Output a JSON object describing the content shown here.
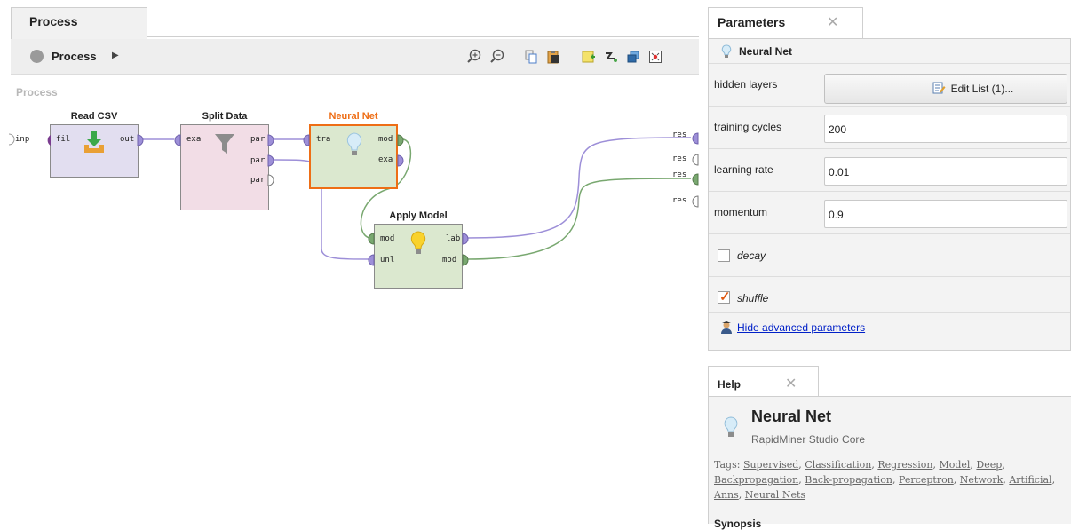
{
  "process_panel": {
    "tab_label": "Process",
    "breadcrumb": "Process",
    "canvas_label": "Process",
    "input_port": "inp",
    "toolbar_icons": [
      "zoom-in-icon",
      "zoom-out-icon",
      "copy-icon",
      "paste-icon",
      "add-note-icon",
      "auto-wire-icon",
      "layers-icon",
      "fit-view-icon"
    ],
    "result_ports": [
      "res",
      "res",
      "res",
      "res"
    ],
    "operators": {
      "read_csv": {
        "title": "Read CSV",
        "in": [
          "fil"
        ],
        "out": [
          "out"
        ]
      },
      "split_data": {
        "title": "Split Data",
        "in": [
          "exa"
        ],
        "out": [
          "par",
          "par",
          "par"
        ]
      },
      "neural_net": {
        "title": "Neural Net",
        "in": [
          "tra"
        ],
        "out": [
          "mod",
          "exa"
        ]
      },
      "apply_model": {
        "title": "Apply Model",
        "in": [
          "mod",
          "unl"
        ],
        "out": [
          "lab",
          "mod"
        ]
      }
    },
    "colors": {
      "selected_operator_title": "#ee6e16",
      "example_port": "#9d8fd8",
      "model_port": "#79a870",
      "file_port": "#7a3c8f"
    }
  },
  "parameters_panel": {
    "tab_label": "Parameters",
    "operator_name": "Neural Net",
    "params": [
      {
        "label": "hidden layers",
        "button": "Edit List (1)..."
      },
      {
        "label": "training cycles",
        "value": "200"
      },
      {
        "label": "learning rate",
        "value": "0.01"
      },
      {
        "label": "momentum",
        "value": "0.9"
      }
    ],
    "checkboxes": [
      {
        "label": "decay",
        "checked": false
      },
      {
        "label": "shuffle",
        "checked": true
      }
    ],
    "advanced_link": "Hide advanced parameters"
  },
  "help_panel": {
    "tab_label": "Help",
    "title": "Neural Net",
    "subtitle": "RapidMiner Studio Core",
    "tags_prefix": "Tags:",
    "tags": [
      "Supervised",
      "Classification",
      "Regression",
      "Model",
      "Deep",
      "Backpropagation",
      "Back-propagation",
      "Perceptron",
      "Network",
      "Artificial",
      "Anns",
      "Neural Nets"
    ],
    "section_heading": "Synopsis"
  }
}
